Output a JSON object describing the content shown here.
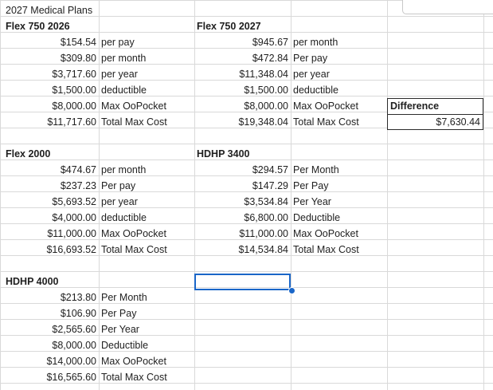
{
  "sheet_title": "2027 Medical Plans",
  "plans": {
    "flex750_2026": {
      "name": "Flex 750 2026",
      "rows": [
        {
          "value": "$154.54",
          "label": "per pay"
        },
        {
          "value": "$309.80",
          "label": "per month"
        },
        {
          "value": "$3,717.60",
          "label": "per year"
        },
        {
          "value": "$1,500.00",
          "label": "deductible"
        },
        {
          "value": "$8,000.00",
          "label": "Max OoPocket"
        },
        {
          "value": "$11,717.60",
          "label": "Total Max Cost"
        }
      ]
    },
    "flex750_2027": {
      "name": "Flex 750 2027",
      "rows": [
        {
          "value": "$945.67",
          "label": "per month"
        },
        {
          "value": "$472.84",
          "label": "Per pay"
        },
        {
          "value": "$11,348.04",
          "label": "per year"
        },
        {
          "value": "$1,500.00",
          "label": "deductible"
        },
        {
          "value": "$8,000.00",
          "label": "Max OoPocket"
        },
        {
          "value": "$19,348.04",
          "label": "Total Max Cost"
        }
      ]
    },
    "flex2000": {
      "name": "Flex 2000",
      "rows": [
        {
          "value": "$474.67",
          "label": "per month"
        },
        {
          "value": "$237.23",
          "label": "Per pay"
        },
        {
          "value": "$5,693.52",
          "label": "per year"
        },
        {
          "value": "$4,000.00",
          "label": "deductible"
        },
        {
          "value": "$11,000.00",
          "label": "Max OoPocket"
        },
        {
          "value": "$16,693.52",
          "label": "Total Max Cost"
        }
      ]
    },
    "hdhp3400": {
      "name": "HDHP 3400",
      "rows": [
        {
          "value": "$294.57",
          "label": "Per Month"
        },
        {
          "value": "$147.29",
          "label": "Per Pay"
        },
        {
          "value": "$3,534.84",
          "label": "Per Year"
        },
        {
          "value": "$6,800.00",
          "label": "Deductible"
        },
        {
          "value": "$11,000.00",
          "label": "Max OoPocket"
        },
        {
          "value": "$14,534.84",
          "label": "Total Max Cost"
        }
      ]
    },
    "hdhp4000": {
      "name": "HDHP 4000",
      "rows": [
        {
          "value": "$213.80",
          "label": "Per Month"
        },
        {
          "value": "$106.90",
          "label": "Per Pay"
        },
        {
          "value": "$2,565.60",
          "label": "Per Year"
        },
        {
          "value": "$8,000.00",
          "label": "Deductible"
        },
        {
          "value": "$14,000.00",
          "label": "Max OoPocket"
        },
        {
          "value": "$16,565.60",
          "label": "Total Max Cost"
        }
      ]
    }
  },
  "difference": {
    "label": "Difference",
    "value": "$7,630.44"
  }
}
